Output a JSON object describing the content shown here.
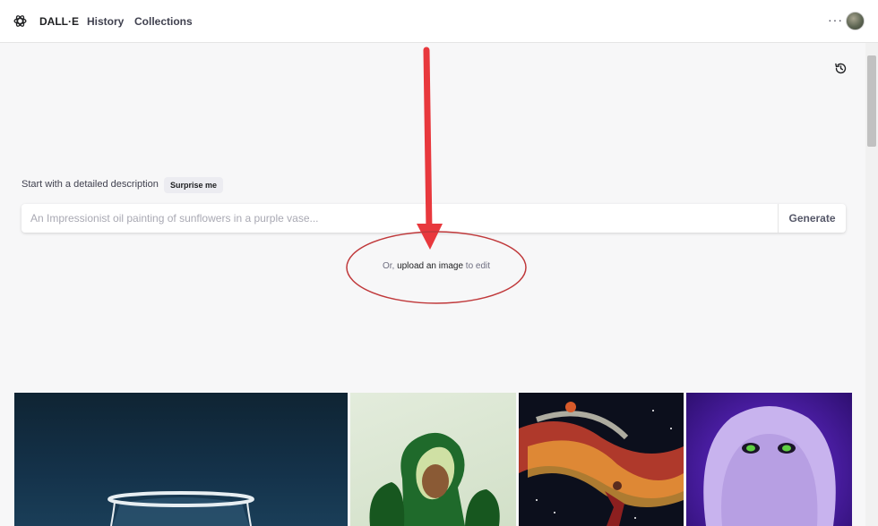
{
  "header": {
    "brand": "DALL·E",
    "nav": {
      "history": "History",
      "collections": "Collections"
    },
    "more_label": "···",
    "icons": {
      "logo": "openai-logo-icon",
      "more": "more-horizontal-icon",
      "avatar": "user-avatar"
    }
  },
  "main": {
    "history_icon": "history-clock-icon",
    "prompt_label": "Start with a detailed description",
    "surprise_label": "Surprise me",
    "prompt_placeholder": "An Impressionist oil painting of sunflowers in a purple vase...",
    "generate_label": "Generate",
    "upload_prefix": "Or, ",
    "upload_link": "upload an image",
    "upload_suffix": " to edit"
  },
  "annotation": {
    "arrow_color": "#e8383d",
    "ellipse_color": "#c0393b"
  },
  "gallery": [
    {
      "icon": "glass-bowl-image"
    },
    {
      "icon": "avocado-chair-image"
    },
    {
      "icon": "space-basketball-image"
    },
    {
      "icon": "purple-monster-image"
    }
  ]
}
